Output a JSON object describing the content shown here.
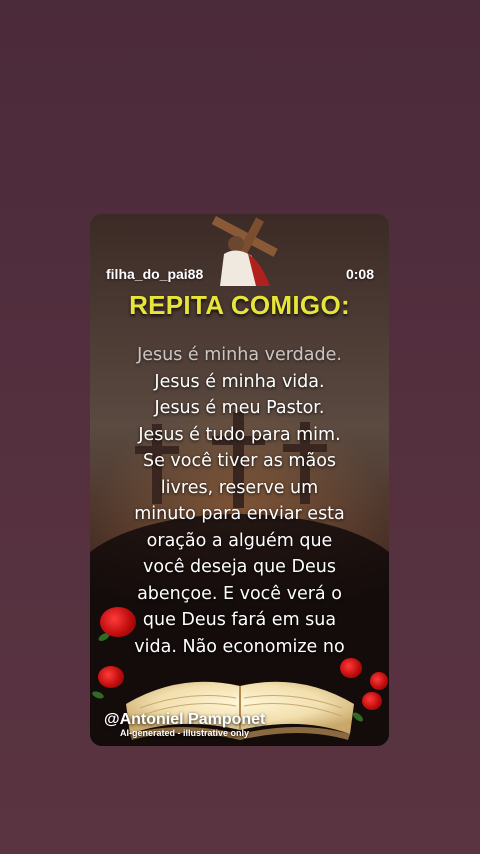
{
  "video": {
    "username": "filha_do_pai88",
    "timer": "0:08",
    "title": "REPITA COMIGO:",
    "lines": [
      "Jesus é minha verdade.",
      "Jesus é minha vida.",
      "Jesus é meu Pastor.",
      "Jesus é tudo para mim.",
      "Se você tiver as mãos",
      "livres, reserve um",
      "minuto para enviar esta",
      "oração a alguém que",
      "você deseja que Deus",
      "abençoe. E você verá o",
      "que Deus fará em sua",
      "vida. Não economize no"
    ],
    "watermark": "@Antoniel Pamponet",
    "ai_note": "AI-generated - illustrative only"
  },
  "colors": {
    "background": "#4b2a3a",
    "title": "#e8e53a",
    "text": "#ffffff"
  }
}
